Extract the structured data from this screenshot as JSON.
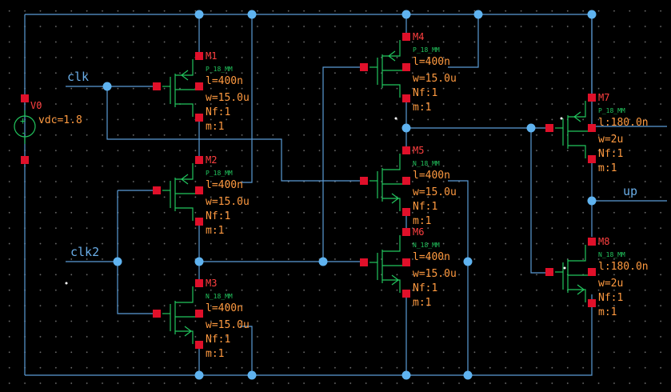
{
  "nets": {
    "clk": "clk",
    "clk2": "clk2",
    "up": "up"
  },
  "source": {
    "name": "V0",
    "param": "vdc=1.8"
  },
  "devices": [
    {
      "name": "M1",
      "model": "P_18_MM",
      "l": "l=400n",
      "w": "w=15.0u",
      "nf": "Nf:1",
      "m": "m:1"
    },
    {
      "name": "M2",
      "model": "P_18_MM",
      "l": "l=400n",
      "w": "w=15.0u",
      "nf": "Nf:1",
      "m": "m:1"
    },
    {
      "name": "M3",
      "model": "N_18_MM",
      "l": "l=400n",
      "w": "w=15.0u",
      "nf": "Nf:1",
      "m": "m:1"
    },
    {
      "name": "M4",
      "model": "P_18_MM",
      "l": "l=400n",
      "w": "w=15.0u",
      "nf": "Nf:1",
      "m": "m:1"
    },
    {
      "name": "M5",
      "model": "N_18_MM",
      "l": "l=400n",
      "w": "w=15.0u",
      "nf": "Nf:1",
      "m": "m:1"
    },
    {
      "name": "M6",
      "model": "N_18_MM",
      "l": "l=400n",
      "w": "w=15.0u",
      "nf": "Nf:1",
      "m": "m:1"
    },
    {
      "name": "M7",
      "model": "P_18_MM",
      "l": "l:180.0n",
      "w": "w=2u",
      "nf": "Nf:1",
      "m": "m:1"
    },
    {
      "name": "M8",
      "model": "N_18_MM",
      "l": "l:180.0n",
      "w": "w=2u",
      "nf": "Nf:1",
      "m": "m:1"
    }
  ],
  "colors": {
    "background": "#000000",
    "wire": "#5b9bd5",
    "device": "#22c55e",
    "pin": "#e0102a",
    "instance_name": "#ff4040",
    "parameter": "#ff9a40"
  }
}
